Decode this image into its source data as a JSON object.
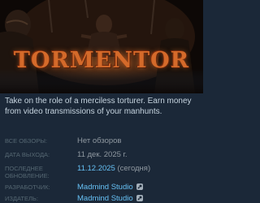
{
  "game": {
    "logo_text": "TORMENTOR",
    "description": "Take on the role of a merciless torturer. Earn money from video transmissions of your manhunts."
  },
  "info": {
    "reviews": {
      "label": "ВСЕ ОБЗОРЫ:",
      "value": "Нет обзоров"
    },
    "release_date": {
      "label": "ДАТА ВЫХОДА:",
      "value": "11 дек. 2025 г."
    },
    "last_update": {
      "label": "ПОСЛЕДНЕЕ ОБНОВЛЕНИЕ:",
      "date": "11.12.2025",
      "note": "(сегодня)"
    },
    "developer": {
      "label": "РАЗРАБОТЧИК:",
      "value": "Madmind Studio",
      "icon": "steam-curator-icon"
    },
    "publisher": {
      "label": "ИЗДАТЕЛЬ:",
      "value": "Madmind Studio",
      "icon": "steam-curator-icon"
    }
  },
  "colors": {
    "background": "#1b2838",
    "text": "#c6d4df",
    "label": "#556772",
    "value": "#8f98a0",
    "link": "#66c0f4",
    "logo": "#d46a2a"
  }
}
